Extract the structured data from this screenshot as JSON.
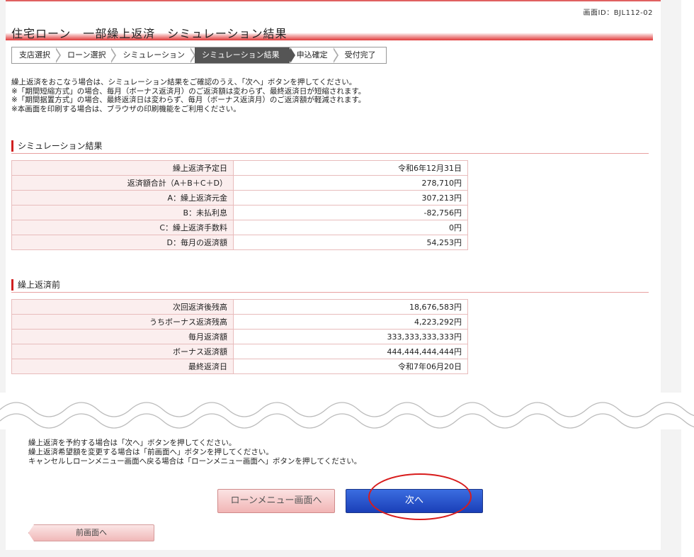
{
  "header": {
    "screen_id": "画面ID：BJL112-02",
    "title": "住宅ローン　一部繰上返済　シミュレーション結果"
  },
  "breadcrumb": [
    {
      "label": "支店選択"
    },
    {
      "label": "ローン選択"
    },
    {
      "label": "シミュレーション"
    },
    {
      "label": "シミュレーション結果",
      "active": true
    },
    {
      "label": "申込確定"
    },
    {
      "label": "受付完了"
    }
  ],
  "intro": {
    "line1": "繰上返済をおこなう場合は、シミュレーション結果をご確認のうえ、「次へ」ボタンを押してください。",
    "line2": "※「期間短縮方式」の場合、毎月（ボーナス返済月）のご返済額は変わらず、最終返済日が短縮されます。",
    "line3": "※「期間据置方式」の場合、最終返済日は変わらず、毎月（ボーナス返済月）のご返済額が軽減されます。",
    "line4": "※本画面を印刷する場合は、ブラウザの印刷機能をご利用ください。"
  },
  "simulation": {
    "heading": "シミュレーション結果",
    "rows": [
      {
        "label": "繰上返済予定日",
        "value": "令和6年12月31日"
      },
      {
        "label": "返済額合計（A＋B＋C＋D）",
        "value": "278,710円"
      },
      {
        "label": "A：繰上返済元金",
        "value": "307,213円"
      },
      {
        "label": "B：未払利息",
        "value": "-82,756円"
      },
      {
        "label": "C：繰上返済手数料",
        "value": "0円"
      },
      {
        "label": "D：毎月の返済額",
        "value": "54,253円"
      }
    ]
  },
  "before": {
    "heading": "繰上返済前",
    "rows": [
      {
        "label": "次回返済後残高",
        "value": "18,676,583円"
      },
      {
        "label": "うちボーナス返済残高",
        "value": "4,223,292円"
      },
      {
        "label": "毎月返済額",
        "value": "333,333,333,333円"
      },
      {
        "label": "ボーナス返済額",
        "value": "444,444,444,444円"
      },
      {
        "label": "最終返済日",
        "value": "令和7年06月20日"
      }
    ]
  },
  "notes": {
    "line1": "繰上返済を予約する場合は「次へ」ボタンを押してください。",
    "line2": "繰上返済希望額を変更する場合は「前画面へ」ボタンを押してください。",
    "line3": "キャンセルしローンメニュー画面へ戻る場合は「ローンメニュー画面へ」ボタンを押してください。"
  },
  "buttons": {
    "loan_menu": "ローンメニュー画面へ",
    "next": "次へ",
    "prev": "前画面へ"
  },
  "colors": {
    "accent_red": "#e03a3a",
    "next_button_blue": "#1a3fb8",
    "highlight_ring": "#d81c1c"
  }
}
